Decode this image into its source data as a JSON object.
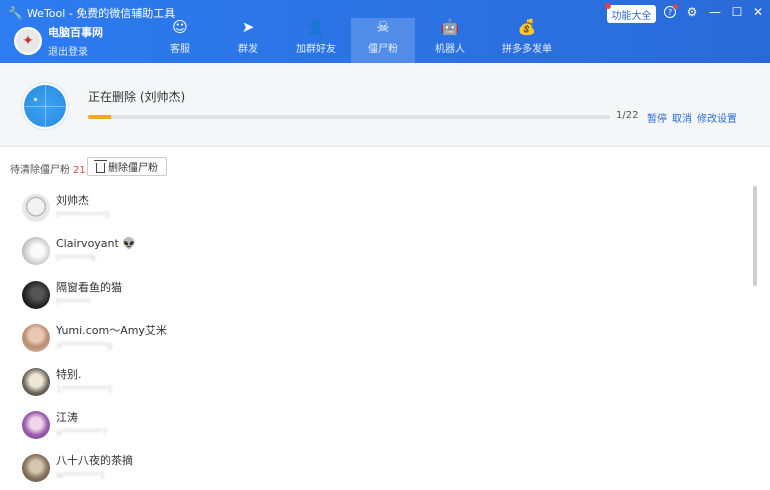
{
  "app": {
    "title": "WeTool - 免费的微信辅助工具",
    "feature_button": "功能大全",
    "help_icon": "?",
    "settings_icon": "⚙",
    "minimize_icon": "—",
    "maximize_icon": "☐",
    "close_icon": "✕"
  },
  "user": {
    "name": "电脑百事网",
    "logout": "退出登录"
  },
  "nav": [
    {
      "label": "客服",
      "icon": "☺"
    },
    {
      "label": "群发",
      "icon": "➤"
    },
    {
      "label": "加群好友",
      "icon": "👤"
    },
    {
      "label": "僵尸粉",
      "icon": "☠"
    },
    {
      "label": "机器人",
      "icon": "🤖"
    },
    {
      "label": "拼多多发单",
      "icon": "💰"
    }
  ],
  "progress": {
    "status_text": "正在删除 (刘帅杰)",
    "count": "1/22",
    "fraction": 0.045,
    "pause": "暂停",
    "cancel": "取消",
    "settings": "修改设置"
  },
  "pending": {
    "label": "待清除僵尸粉",
    "count": "21",
    "delete_button": "删除僵尸粉"
  },
  "contacts": [
    {
      "name": "刘帅杰",
      "sub": "l**********3"
    },
    {
      "name": "Clairvoyant 👽",
      "sub": "t*******k"
    },
    {
      "name": "隔窗看鱼的猫",
      "sub": "f*******"
    },
    {
      "name": "Yumi.com～Amy艾米",
      "sub": "a**********g"
    },
    {
      "name": "特别.",
      "sub": "1**********5"
    },
    {
      "name": "江涛",
      "sub": "a*********7"
    },
    {
      "name": "八十八夜的茶摘",
      "sub": "w********1"
    }
  ],
  "colors": {
    "header": "#2a6ad8",
    "accent": "#2a6ad8",
    "progress_fill": "#f5a623",
    "count_red": "#e64343"
  }
}
